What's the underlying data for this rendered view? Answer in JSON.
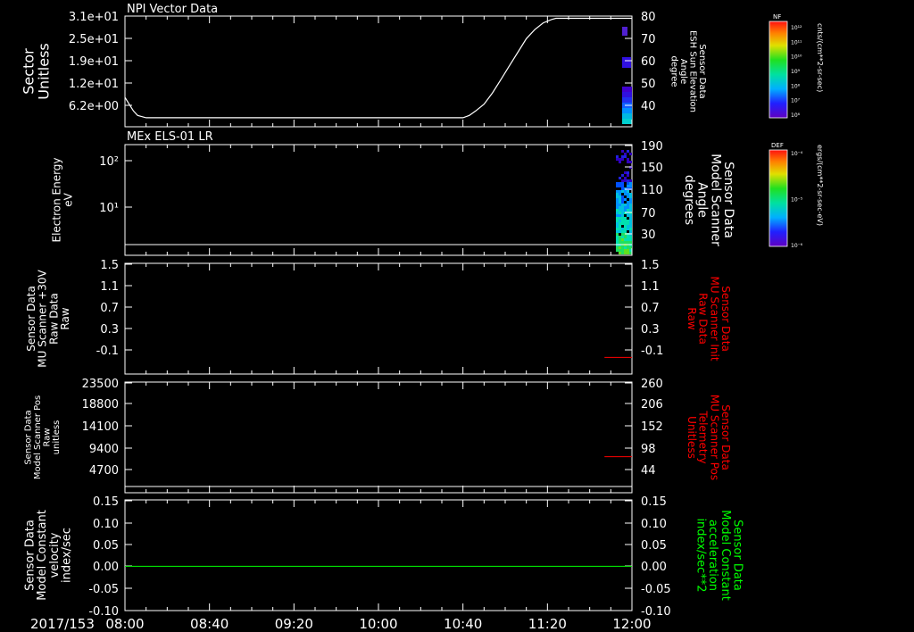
{
  "x_axis": {
    "date": "2017/153",
    "ticks": [
      "08:00",
      "08:40",
      "09:20",
      "10:00",
      "10:40",
      "11:20",
      "12:00"
    ],
    "range_minutes": [
      0,
      240
    ]
  },
  "colors": {
    "background": "#000000",
    "axis": "#ffffff",
    "red": "#ff0000",
    "green": "#00ff00",
    "blue": "#0000ff"
  },
  "colorbars": [
    {
      "label": "NF",
      "unit": "cnts/(cm**2-sr-sec)",
      "tick_labels": [
        "10¹²",
        "10¹¹",
        "10¹⁰",
        "10⁹",
        "10⁸",
        "10⁷",
        "10⁶"
      ]
    },
    {
      "label": "DEF",
      "unit": "ergs/(cm**2-sr-sec-eV)",
      "tick_labels": [
        "10⁻⁴",
        "10⁻⁵",
        "10⁻⁶"
      ]
    }
  ],
  "chart_data": [
    {
      "type": "line",
      "title": "NPI Vector Data",
      "ylabel": [
        "Sector",
        "Unitless"
      ],
      "y_ticks": [
        "3.1e+01",
        "2.5e+01",
        "1.9e+01",
        "1.2e+01",
        "6.2e+00"
      ],
      "ylim": [
        0,
        31
      ],
      "ylabel_right": [
        "Sensor Data",
        "ESH Sun Elevation",
        "Angle",
        "degree"
      ],
      "y_ticks_right": [
        "80",
        "70",
        "60",
        "50",
        "40"
      ],
      "ylim_right": [
        31,
        80
      ],
      "series": [
        {
          "x": [
            0,
            2,
            4,
            6,
            10,
            20,
            60,
            100,
            150,
            160,
            163,
            166,
            170,
            174,
            178,
            182,
            186,
            190,
            194,
            198,
            202,
            204,
            207,
            210,
            240
          ],
          "y": [
            44,
            41,
            38,
            36,
            35,
            35,
            35,
            35,
            35,
            35,
            36,
            38,
            41,
            46,
            52,
            58,
            64,
            70,
            74,
            77,
            78.5,
            79,
            79,
            79,
            79
          ]
        }
      ]
    },
    {
      "type": "heatmap",
      "title": "MEx ELS-01 LR",
      "ylabel": [
        "Electron Energy",
        "eV"
      ],
      "y_ticks": [
        "10²",
        "10¹"
      ],
      "yscale": "log",
      "ylabel_right": [
        "Sensor Data",
        "Model Scanner",
        "Angle",
        "degrees"
      ],
      "y_ticks_right": [
        "190",
        "150",
        "110",
        "70",
        "30"
      ],
      "ylim_right": [
        0,
        190
      ],
      "series": [
        {
          "x": [
            0,
            240
          ],
          "y": [
            3.8,
            3.8
          ]
        }
      ]
    },
    {
      "type": "line",
      "ylabel": [
        "Sensor Data",
        "MU Scanner +30V",
        "Raw Data",
        "Raw"
      ],
      "y_ticks": [
        "1.5",
        "1.1",
        "0.7",
        "0.3",
        "-0.1"
      ],
      "ylim": [
        -0.3,
        1.5
      ],
      "ylabel_right": [
        "Sensor Data",
        "MU Scanner Init",
        "Raw Data",
        "Raw"
      ],
      "y_ticks_right": [
        "1.5",
        "1.1",
        "0.7",
        "0.3",
        "-0.1"
      ],
      "ylim_right": [
        -0.3,
        1.5
      ],
      "series": [
        {
          "x": [
            227,
            240
          ],
          "y": [
            -0.03,
            -0.03
          ]
        }
      ]
    },
    {
      "type": "line",
      "ylabel": [
        "Sensor Data",
        "Model Scanner Pos",
        "Raw",
        "unitless"
      ],
      "y_ticks": [
        "23500",
        "18800",
        "14100",
        "9400",
        "4700"
      ],
      "ylim": [
        0,
        23500
      ],
      "ylabel_right": [
        "Sensor Data",
        "MU Scanner Pos",
        "Telemetry",
        "Unitless"
      ],
      "y_ticks_right": [
        "260",
        "206",
        "152",
        "98",
        "44"
      ],
      "ylim_right": [
        -10,
        260
      ],
      "series": [
        {
          "x": [
            0,
            240
          ],
          "y": [
            0,
            0
          ]
        },
        {
          "x": [
            227,
            240
          ],
          "y": [
            78,
            78
          ]
        }
      ]
    },
    {
      "type": "line",
      "ylabel": [
        "Sensor Data",
        "Model Constant",
        "velocity",
        "index/sec"
      ],
      "y_ticks": [
        "0.15",
        "0.10",
        "0.05",
        "0.00",
        "-0.05",
        "-0.10"
      ],
      "ylim": [
        -0.1,
        0.15
      ],
      "ylabel_right": [
        "Sensor Data",
        "Model Constant",
        "acceleration",
        "index/sec**2"
      ],
      "y_ticks_right": [
        "0.15",
        "0.10",
        "0.05",
        "0.00",
        "-0.05",
        "-0.10"
      ],
      "ylim_right": [
        -0.1,
        0.15
      ],
      "series": [
        {
          "x": [
            0,
            240
          ],
          "y": [
            0,
            0
          ]
        }
      ]
    }
  ]
}
